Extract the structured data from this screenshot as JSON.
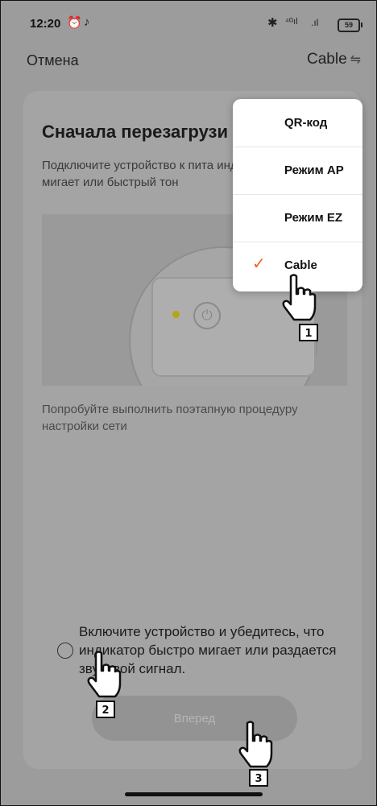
{
  "status_bar": {
    "time": "12:20",
    "icons": [
      "alarm-icon",
      "tiktok-icon",
      "bluetooth-icon",
      "signal-4g-icon",
      "signal-icon",
      "battery-icon"
    ],
    "battery": "59"
  },
  "top_bar": {
    "cancel": "Отмена",
    "mode": "Cable"
  },
  "card": {
    "title": "Сначала перезагрузи",
    "description": "Подключите устройство к пита индикатор быстро мигает или быстрый тон",
    "hint": "Попробуйте выполнить поэтапную процедуру настройки сети",
    "confirm": "Включите устройство и убедитесь, что индикатор быстро мигает или раздается звуковой сигнал.",
    "next_button": "Вперед"
  },
  "menu": {
    "items": [
      {
        "label": "QR-код",
        "selected": false
      },
      {
        "label": "Режим AP",
        "selected": false
      },
      {
        "label": "Режим EZ",
        "selected": false
      },
      {
        "label": "Cable",
        "selected": true
      }
    ],
    "check_color": "#ff5a1f"
  },
  "steps": [
    "1",
    "2",
    "3"
  ]
}
